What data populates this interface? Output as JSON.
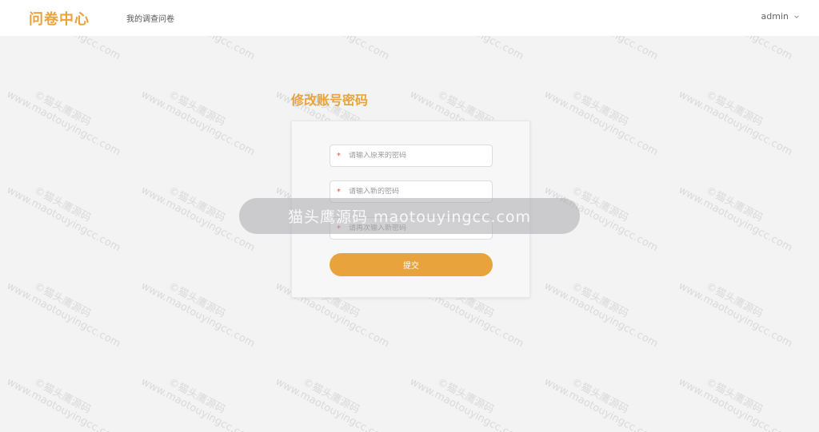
{
  "header": {
    "logo": "问卷中心",
    "nav_link": "我的调查问卷",
    "user_name": "admin"
  },
  "main": {
    "title": "修改账号密码",
    "fields": [
      {
        "placeholder": "请输入原来的密码",
        "required_mark": "*"
      },
      {
        "placeholder": "请输入新的密码",
        "required_mark": "*"
      },
      {
        "placeholder": "请再次输入新密码",
        "required_mark": "*"
      }
    ],
    "submit_label": "提交"
  },
  "watermark": {
    "banner_text": "猫头鹰源码 maotouyingcc.com",
    "tile_line1": "©猫头鹰源码",
    "tile_line2": "www.maotouyingcc.com"
  },
  "colors": {
    "accent": "#e8a33d",
    "background": "#f3f3f3",
    "required": "#e05050"
  }
}
